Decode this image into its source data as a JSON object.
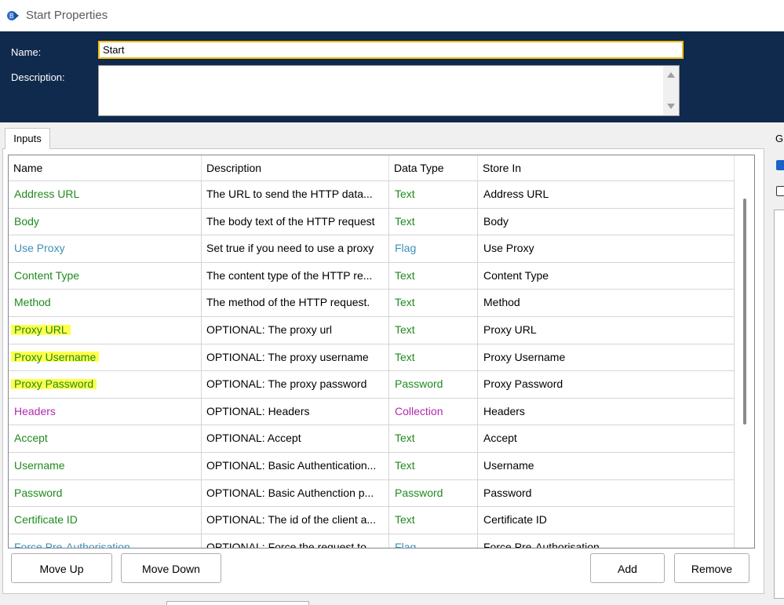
{
  "window": {
    "title": "Start Properties",
    "icon": "blueprism-app-icon"
  },
  "header": {
    "name_label": "Name:",
    "name_value": "Start",
    "description_label": "Description:",
    "description_value": ""
  },
  "tabs": [
    {
      "label": "Inputs",
      "selected": true
    }
  ],
  "right_panel": {
    "group_label_fragment": "G"
  },
  "grid": {
    "columns": [
      "Name",
      "Description",
      "Data Type",
      "Store In"
    ],
    "rows": [
      {
        "name": "Address URL",
        "description": "The URL to send the HTTP data...",
        "data_type": "Text",
        "store_in": "Address URL",
        "type_color": "green",
        "highlighted": false
      },
      {
        "name": "Body",
        "description": "The body text of the HTTP request",
        "data_type": "Text",
        "store_in": "Body",
        "type_color": "green",
        "highlighted": false
      },
      {
        "name": "Use Proxy",
        "description": "Set true if you need to use a proxy",
        "data_type": "Flag",
        "store_in": "Use Proxy",
        "type_color": "blue",
        "highlighted": false
      },
      {
        "name": "Content Type",
        "description": "The content type of the HTTP re...",
        "data_type": "Text",
        "store_in": "Content Type",
        "type_color": "green",
        "highlighted": false
      },
      {
        "name": "Method",
        "description": "The method of the HTTP request.",
        "data_type": "Text",
        "store_in": "Method",
        "type_color": "green",
        "highlighted": false
      },
      {
        "name": "Proxy URL",
        "description": "OPTIONAL: The proxy url",
        "data_type": "Text",
        "store_in": "Proxy URL",
        "type_color": "green",
        "highlighted": true
      },
      {
        "name": "Proxy Username",
        "description": "OPTIONAL: The proxy username",
        "data_type": "Text",
        "store_in": "Proxy Username",
        "type_color": "green",
        "highlighted": true
      },
      {
        "name": "Proxy Password",
        "description": "OPTIONAL: The proxy password",
        "data_type": "Password",
        "store_in": "Proxy Password",
        "type_color": "green",
        "highlighted": true
      },
      {
        "name": "Headers",
        "description": "OPTIONAL: Headers",
        "data_type": "Collection",
        "store_in": "Headers",
        "type_color": "magenta",
        "highlighted": false
      },
      {
        "name": "Accept",
        "description": "OPTIONAL: Accept",
        "data_type": "Text",
        "store_in": "Accept",
        "type_color": "green",
        "highlighted": false
      },
      {
        "name": "Username",
        "description": "OPTIONAL: Basic Authentication...",
        "data_type": "Text",
        "store_in": "Username",
        "type_color": "green",
        "highlighted": false
      },
      {
        "name": "Password",
        "description": "OPTIONAL: Basic Authenction p...",
        "data_type": "Password",
        "store_in": "Password",
        "type_color": "green",
        "highlighted": false
      },
      {
        "name": "Certificate ID",
        "description": "OPTIONAL: The id of the client a...",
        "data_type": "Text",
        "store_in": "Certificate ID",
        "type_color": "green",
        "highlighted": false
      },
      {
        "name": "Force Pre-Authorisation",
        "description": "OPTIONAL: Force the request to...",
        "data_type": "Flag",
        "store_in": "Force Pre-Authorisation",
        "type_color": "blue",
        "highlighted": false
      }
    ]
  },
  "buttons": {
    "move_up": "Move Up",
    "move_down": "Move Down",
    "add": "Add",
    "remove": "Remove"
  },
  "colors": {
    "header_bg": "#0f2a4c",
    "name_focus_border": "#f5bd12",
    "type_text_green": "#1f8a1f",
    "type_flag_blue": "#3d8fb6",
    "type_collection_magenta": "#b02ab0",
    "highlighter_yellow": "#ffff4a"
  }
}
